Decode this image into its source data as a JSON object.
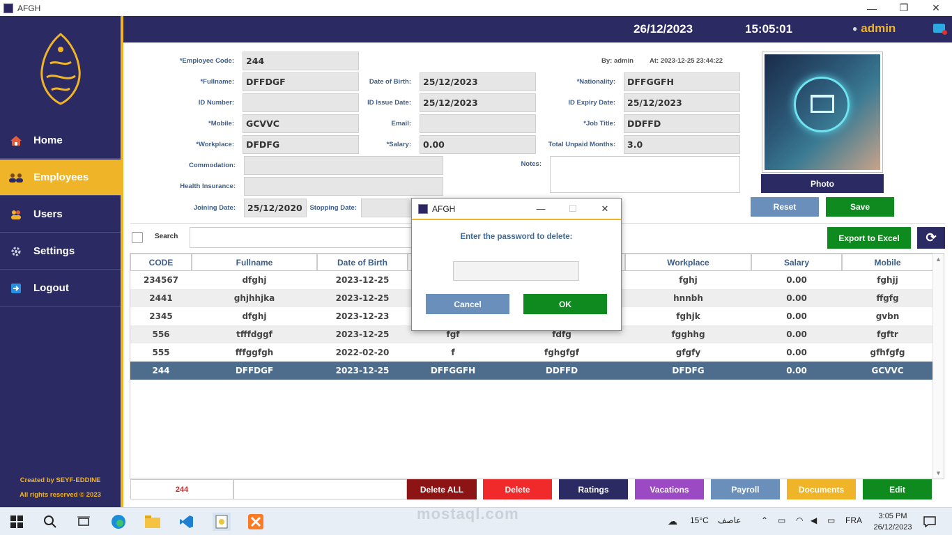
{
  "window": {
    "title": "AFGH",
    "min": "—",
    "max": "❐",
    "close": "✕"
  },
  "header": {
    "date": "26/12/2023",
    "time": "15:05:01",
    "user": "admin"
  },
  "sidebar": {
    "items": [
      {
        "label": "Home",
        "icon": "home-icon"
      },
      {
        "label": "Employees",
        "icon": "employees-icon"
      },
      {
        "label": "Users",
        "icon": "users-icon"
      },
      {
        "label": "Settings",
        "icon": "gear-icon"
      },
      {
        "label": "Logout",
        "icon": "logout-icon"
      }
    ],
    "credits_line1": "Created by SEYF-EDDINE",
    "credits_line2": "All rights reserved © 2023"
  },
  "form": {
    "employee_code_label": "*Employee Code:",
    "employee_code": "244",
    "by_label": "By: admin",
    "at_label": "At: 2023-12-25 23:44:22",
    "fullname_label": "*Fullname:",
    "fullname": "DFFDGF",
    "dob_label": "Date of Birth:",
    "dob": "25/12/2023",
    "nationality_label": "*Nationality:",
    "nationality": "DFFGGFH",
    "id_number_label": "ID Number:",
    "id_number": "",
    "id_issue_label": "ID Issue Date:",
    "id_issue": "25/12/2023",
    "id_expiry_label": "ID Expiry Date:",
    "id_expiry": "25/12/2023",
    "mobile_label": "*Mobile:",
    "mobile": "GCVVC",
    "email_label": "Email:",
    "email": "",
    "job_title_label": "*Job Title:",
    "job_title": "DDFFD",
    "workplace_label": "*Workplace:",
    "workplace": "DFDFG",
    "salary_label": "*Salary:",
    "salary": "0.00",
    "unpaid_label": "Total Unpaid Months:",
    "unpaid": "3.0",
    "commodation_label": "Commodation:",
    "notes_label": "Notes:",
    "health_label": "Health Insurance:",
    "joining_label": "Joining Date:",
    "joining": "25/12/2020",
    "stopping_label": "Stopping Date:",
    "photo_button": "Photo",
    "reset_button": "Reset",
    "save_button": "Save"
  },
  "search": {
    "label": "Search",
    "value": ""
  },
  "toolbar": {
    "export_button": "Export to Excel"
  },
  "table": {
    "columns": [
      "CODE",
      "Fullname",
      "Date of Birth",
      "",
      "",
      "Workplace",
      "Salary",
      "Mobile"
    ],
    "rows": [
      [
        "234567",
        "dfghj",
        "2023-12-25",
        "",
        "",
        "fghj",
        "0.00",
        "fghjj"
      ],
      [
        "2441",
        "ghjhhjka",
        "2023-12-25",
        "",
        "",
        "hnnbh",
        "0.00",
        "ffgfg"
      ],
      [
        "2345",
        "dfghj",
        "2023-12-23",
        "",
        "",
        "fghjk",
        "0.00",
        "gvbn"
      ],
      [
        "556",
        "tfffdggf",
        "2023-12-25",
        "fgf",
        "fdfg",
        "fgghhg",
        "0.00",
        "fgftr"
      ],
      [
        "555",
        "fffggfgh",
        "2022-02-20",
        "f",
        "fghgfgf",
        "gfgfy",
        "0.00",
        "gfhfgfg"
      ],
      [
        "244",
        "DFFDGF",
        "2023-12-25",
        "DFFGGFH",
        "DDFFD",
        "DFDFG",
        "0.00",
        "GCVVC"
      ]
    ]
  },
  "footer": {
    "selected_code": "244",
    "delete_all": "Delete ALL",
    "delete": "Delete",
    "ratings": "Ratings",
    "vacations": "Vacations",
    "payroll": "Payroll",
    "documents": "Documents",
    "edit": "Edit"
  },
  "dialog": {
    "title": "AFGH",
    "prompt": "Enter the password to delete:",
    "cancel": "Cancel",
    "ok": "OK"
  },
  "taskbar": {
    "temperature": "15°C",
    "weather": "عاصف",
    "language": "FRA",
    "time": "3:05 PM",
    "date": "26/12/2023"
  },
  "watermark": "mostaql.com",
  "colors": {
    "navy": "#2b2a63",
    "gold": "#f0b429",
    "green": "#0f8a1e",
    "steel": "#6b8fbb"
  }
}
